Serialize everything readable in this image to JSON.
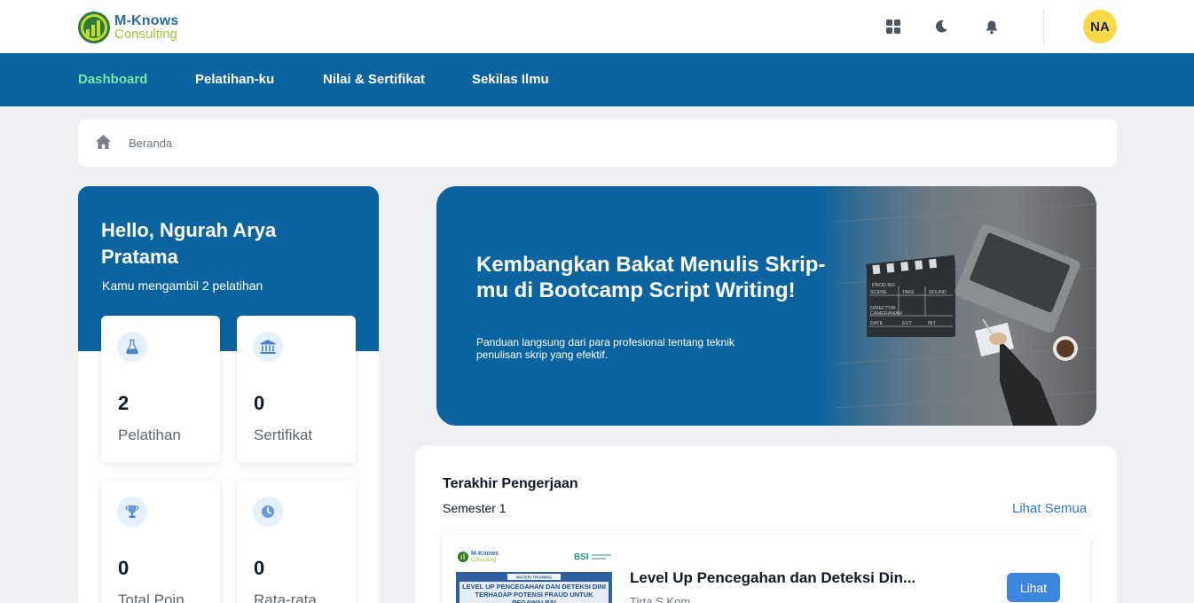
{
  "header": {
    "logo_line1": "M-Knows",
    "logo_line2": "Consulting",
    "avatar_initials": "NA",
    "icons": [
      "apps-grid-icon",
      "moon-icon",
      "bell-icon"
    ]
  },
  "nav": {
    "items": [
      {
        "label": "Dashboard",
        "active": true
      },
      {
        "label": "Pelatihan-ku",
        "active": false
      },
      {
        "label": "Nilai & Sertifikat",
        "active": false
      },
      {
        "label": "Sekilas Ilmu",
        "active": false
      }
    ]
  },
  "breadcrumb": {
    "home_icon": "home-icon",
    "current": "Beranda"
  },
  "profile": {
    "greeting": "Hello, Ngurah Arya Pratama",
    "subtitle": "Kamu mengambil 2 pelatihan",
    "stats": [
      {
        "value": "2",
        "label": "Pelatihan",
        "icon": "flask-icon"
      },
      {
        "value": "0",
        "label": "Sertifikat",
        "icon": "bank-icon"
      },
      {
        "value": "0",
        "label": "Total Poin",
        "icon": "trophy-icon"
      },
      {
        "value": "0",
        "label": "Rata-rata",
        "icon": "clock-icon"
      }
    ]
  },
  "banner": {
    "title": "Kembangkan Bakat Menulis Skrip-mu di Bootcamp Script Writing!",
    "subtitle": "Panduan langsung dari para profesional tentang teknik penulisan skrip yang efektif.",
    "clapper_lines": [
      "PROD.NO.",
      "SCENE",
      "TAKE",
      "SOUND",
      "DIRECTOR",
      "CAMERAMAN",
      "DATE",
      "EXT.",
      "INT."
    ]
  },
  "recent": {
    "title": "Terakhir Pengerjaan",
    "semester": "Semester 1",
    "see_all": "Lihat Semua",
    "course": {
      "thumb_logo": "M-Knows",
      "thumb_logo2": "Consulting",
      "thumb_partner": "BSI",
      "thumb_tag": "MATERI TRAINING",
      "thumb_title": "LEVEL UP PENCEGAHAN DAN DETEKSI DINI TERHADAP POTENSI FRAUD UNTUK PEGAWAI BSI",
      "name": "Level Up Pencegahan dan Deteksi Din...",
      "author": "Tirta S.Kom",
      "button": "Lihat"
    }
  },
  "colors": {
    "primary": "#0b64a0",
    "nav_active": "#7ee3a7",
    "avatar_bg": "#f8d94a",
    "link": "#2f7ad6",
    "button": "#3d86e0",
    "page_bg": "#eef0f3"
  }
}
